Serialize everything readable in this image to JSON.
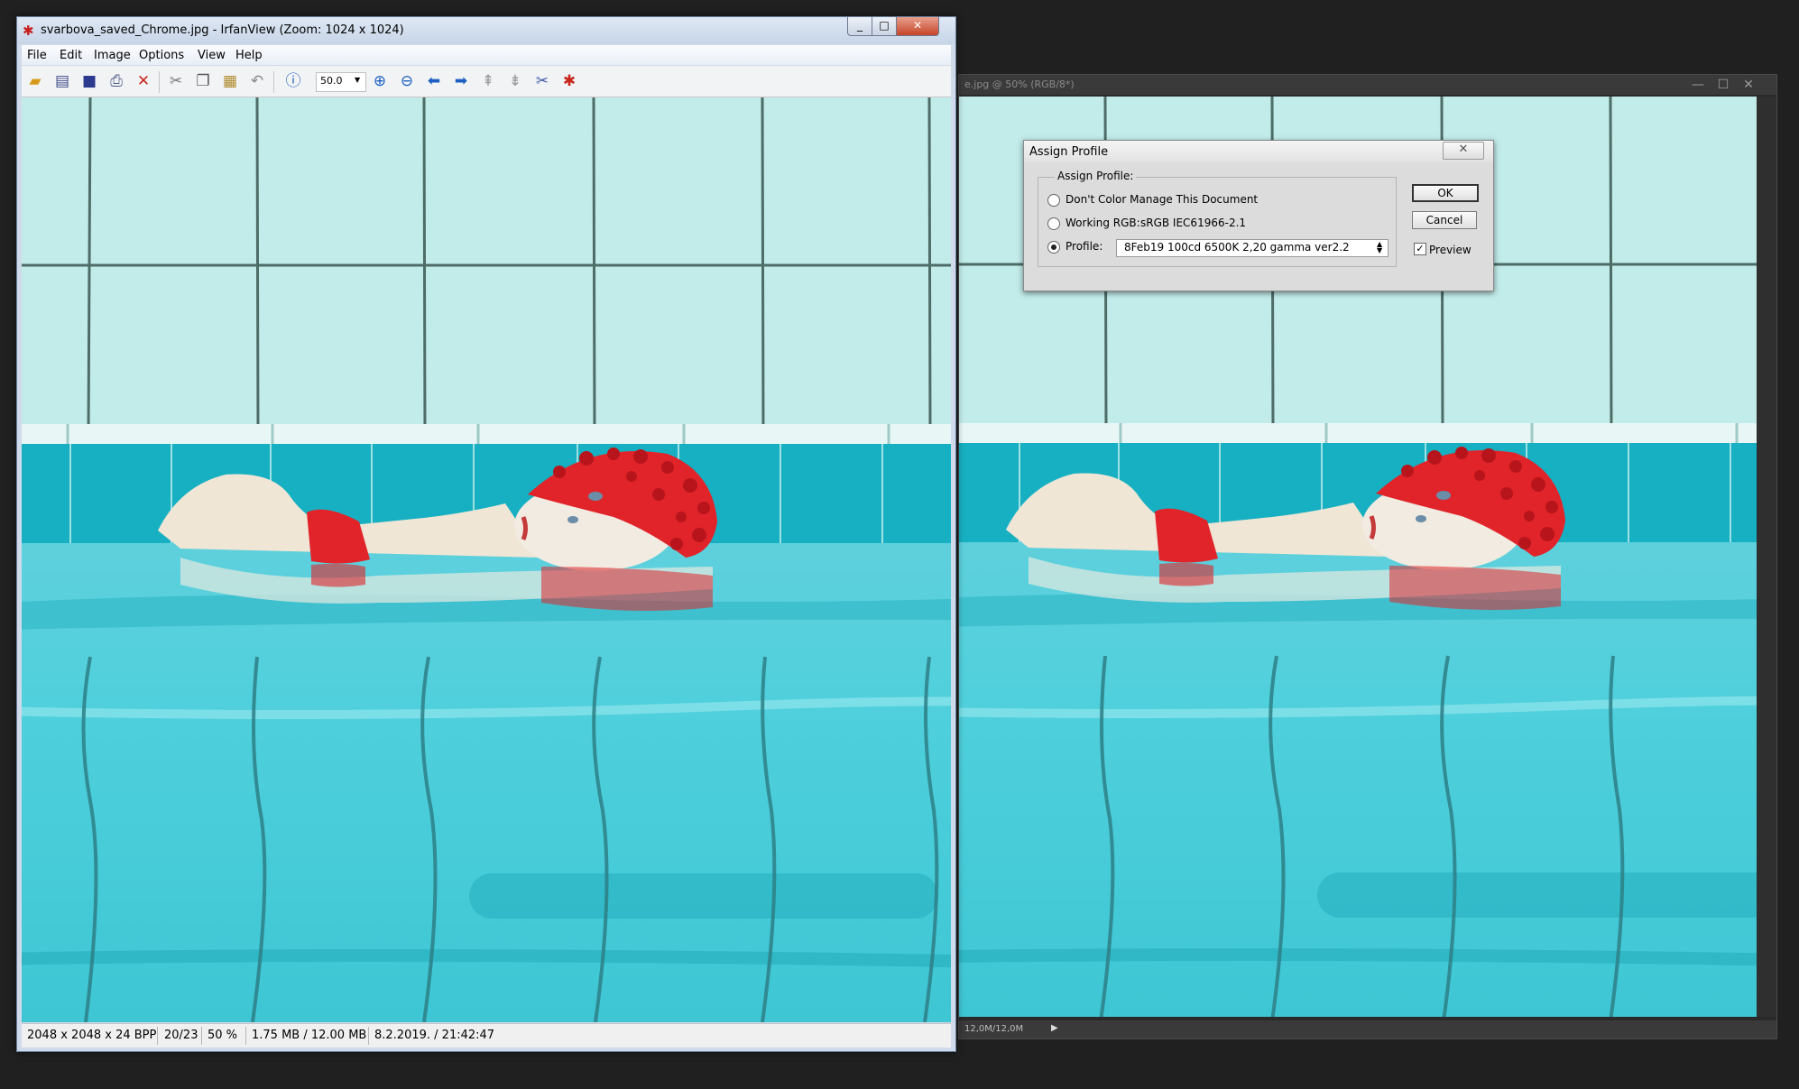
{
  "photoshop": {
    "title": "e.jpg @ 50% (RGB/8*)",
    "status": "12,0M/12,0M",
    "status_arrow": "▶",
    "controls": {
      "minimize": "—",
      "maximize": "☐",
      "close": "✕"
    }
  },
  "irfanview": {
    "app_icon": "irfanview-logo",
    "title": "svarbova_saved_Chrome.jpg - IrfanView (Zoom: 1024 x 1024)",
    "controls": {
      "minimize": "_",
      "maximize": "□",
      "close": "✕"
    },
    "menu": [
      {
        "label": "File"
      },
      {
        "label": "Edit"
      },
      {
        "label": "Image"
      },
      {
        "label": "Options"
      },
      {
        "label": "View"
      },
      {
        "label": "Help"
      }
    ],
    "toolbar": {
      "open_icon": "folder-open-icon",
      "slideshow_icon": "filmstrip-icon",
      "save_icon": "floppy-disk-icon",
      "print_icon": "printer-icon",
      "delete_icon": "delete-x-icon",
      "cut_icon": "scissors-icon",
      "copy_icon": "copy-icon",
      "paste_icon": "paste-icon",
      "undo_icon": "undo-icon",
      "info_icon": "info-icon",
      "zoom_value": "50.0",
      "zoom_in_icon": "zoom-in-icon",
      "zoom_out_icon": "zoom-out-icon",
      "prev_icon": "arrow-left-icon",
      "next_icon": "arrow-right-icon",
      "first_icon": "page-up-icon",
      "last_icon": "page-down-icon",
      "settings_icon": "tools-icon",
      "exit_icon": "irfanview-exit-icon"
    },
    "status": {
      "dimensions": "2048 x 2048 x 24 BPP",
      "index": "20/23",
      "zoom": "50 %",
      "size": "1.75 MB / 12.00 MB",
      "date": "8.2.2019. / 21:42:47"
    }
  },
  "dialog": {
    "title": "Assign Profile",
    "close": "✕",
    "group_title": "Assign Profile:",
    "options": {
      "dont_manage": "Don't Color Manage This Document",
      "working_rgb_label": "Working RGB:",
      "working_rgb_value": "sRGB IEC61966-2.1",
      "profile_label": "Profile:"
    },
    "selected_option": "Profile",
    "profile_value": "8Feb19 100cd 6500K 2,20 gamma ver2.2",
    "ok": "OK",
    "cancel": "Cancel",
    "preview_label": "Preview",
    "preview_checked": true,
    "checkmark": "✓"
  },
  "colors": {
    "tile_light": "#c2ecea",
    "pool_water": "#3ec9d6",
    "swim_cap": "#e0242a"
  }
}
